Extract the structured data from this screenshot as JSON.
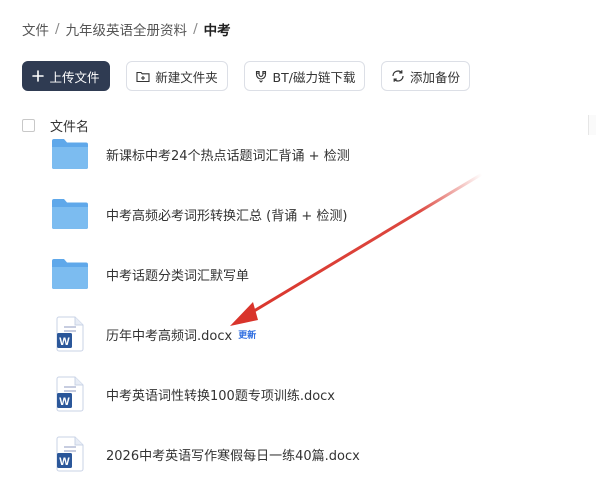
{
  "breadcrumb": {
    "items": [
      "文件",
      "九年级英语全册资料"
    ],
    "separator": "/",
    "current": "中考"
  },
  "toolbar": {
    "upload_label": "上传文件",
    "new_folder_label": "新建文件夹",
    "bt_label": "BT/磁力链下载",
    "backup_label": "添加备份"
  },
  "list": {
    "column_name": "文件名",
    "items": [
      {
        "type": "folder",
        "name": "新课标中考24个热点话题词汇背诵 + 检测"
      },
      {
        "type": "folder",
        "name": "中考高频必考词形转换汇总 (背诵 + 检测)"
      },
      {
        "type": "folder",
        "name": "中考话题分类词汇默写单"
      },
      {
        "type": "docx",
        "name": "历年中考高频词.docx",
        "badge": "更新"
      },
      {
        "type": "docx",
        "name": "中考英语词性转换100题专项训练.docx"
      },
      {
        "type": "docx",
        "name": "2026中考英语写作寒假每日一练40篇.docx"
      }
    ]
  },
  "colors": {
    "primary_button": "#2f3b52",
    "folder": "#5fa8ea",
    "word_icon": "#2b579a",
    "badge": "#2f6ee0",
    "arrow": "#d9342b"
  }
}
